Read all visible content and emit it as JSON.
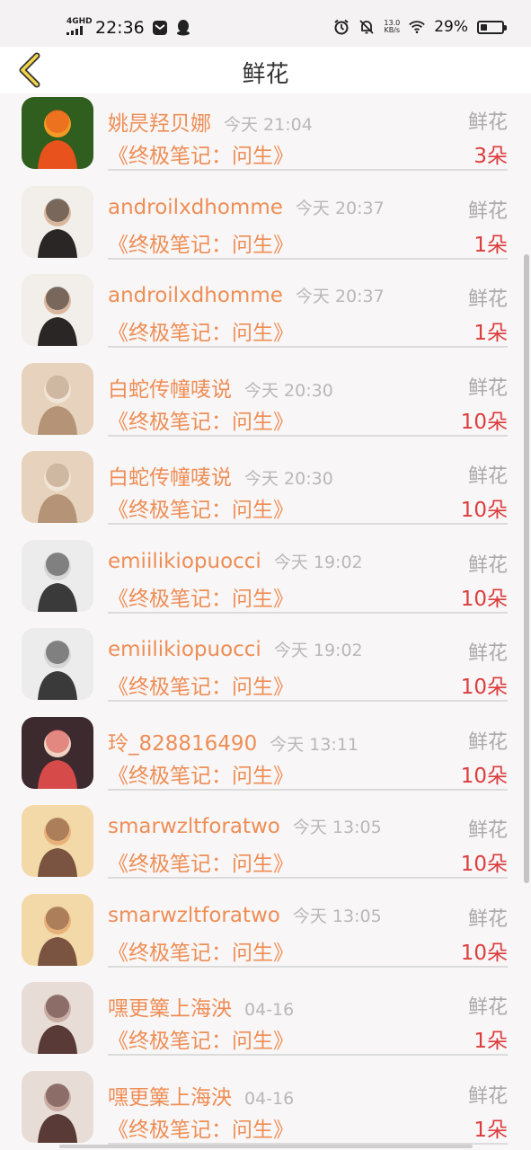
{
  "status_bar": {
    "network": "4GHD",
    "time": "22:36",
    "net_speed_value": "13.0",
    "net_speed_unit": "KB/s",
    "battery": "29%"
  },
  "nav": {
    "title": "鲜花"
  },
  "rows": [
    {
      "name": "姚昃羟贝娜",
      "time": "今天 21:04",
      "label": "鲜花",
      "book": "《终极笔记：问生》",
      "count": "3朵",
      "avatar_colors": [
        "#2f5e1e",
        "#e8521c",
        "#f29a25"
      ]
    },
    {
      "name": "androilxdhomme",
      "time": "今天 20:37",
      "label": "鲜花",
      "book": "《终极笔记：问生》",
      "count": "1朵",
      "avatar_colors": [
        "#f2efea",
        "#2b2626",
        "#d8b79d"
      ]
    },
    {
      "name": "androilxdhomme",
      "time": "今天 20:37",
      "label": "鲜花",
      "book": "《终极笔记：问生》",
      "count": "1朵",
      "avatar_colors": [
        "#f2efea",
        "#2b2626",
        "#d8b79d"
      ]
    },
    {
      "name": "白蛇传幢唛说",
      "time": "今天 20:30",
      "label": "鲜花",
      "book": "《终极笔记：问生》",
      "count": "10朵",
      "avatar_colors": [
        "#e7d3bd",
        "#b59376",
        "#f0e4d4"
      ]
    },
    {
      "name": "白蛇传幢唛说",
      "time": "今天 20:30",
      "label": "鲜花",
      "book": "《终极笔记：问生》",
      "count": "10朵",
      "avatar_colors": [
        "#e7d3bd",
        "#b59376",
        "#f0e4d4"
      ]
    },
    {
      "name": "emiilikiopuocci",
      "time": "今天 19:02",
      "label": "鲜花",
      "book": "《终极笔记：问生》",
      "count": "10朵",
      "avatar_colors": [
        "#ececec",
        "#3a3a3a",
        "#d6d6d6"
      ]
    },
    {
      "name": "emiilikiopuocci",
      "time": "今天 19:02",
      "label": "鲜花",
      "book": "《终极笔记：问生》",
      "count": "10朵",
      "avatar_colors": [
        "#ececec",
        "#3a3a3a",
        "#d6d6d6"
      ]
    },
    {
      "name": "玲_828816490",
      "time": "今天 13:11",
      "label": "鲜花",
      "book": "《终极笔记：问生》",
      "count": "10朵",
      "avatar_colors": [
        "#3c2a2e",
        "#d64a4a",
        "#f1d2c2"
      ]
    },
    {
      "name": "smarwzltforatwo",
      "time": "今天 13:05",
      "label": "鲜花",
      "book": "《终极笔记：问生》",
      "count": "10朵",
      "avatar_colors": [
        "#f3d9a8",
        "#7a5440",
        "#e9b17a"
      ]
    },
    {
      "name": "smarwzltforatwo",
      "time": "今天 13:05",
      "label": "鲜花",
      "book": "《终极笔记：问生》",
      "count": "10朵",
      "avatar_colors": [
        "#f3d9a8",
        "#7a5440",
        "#e9b17a"
      ]
    },
    {
      "name": "嘿更篥上海泱",
      "time": "04-16",
      "label": "鲜花",
      "book": "《终极笔记：问生》",
      "count": "1朵",
      "avatar_colors": [
        "#e8dcd6",
        "#5a3a36",
        "#c9aca4"
      ]
    },
    {
      "name": "嘿更篥上海泱",
      "time": "04-16",
      "label": "鲜花",
      "book": "《终极笔记：问生》",
      "count": "1朵",
      "avatar_colors": [
        "#e8dcd6",
        "#5a3a36",
        "#c9aca4"
      ]
    }
  ]
}
